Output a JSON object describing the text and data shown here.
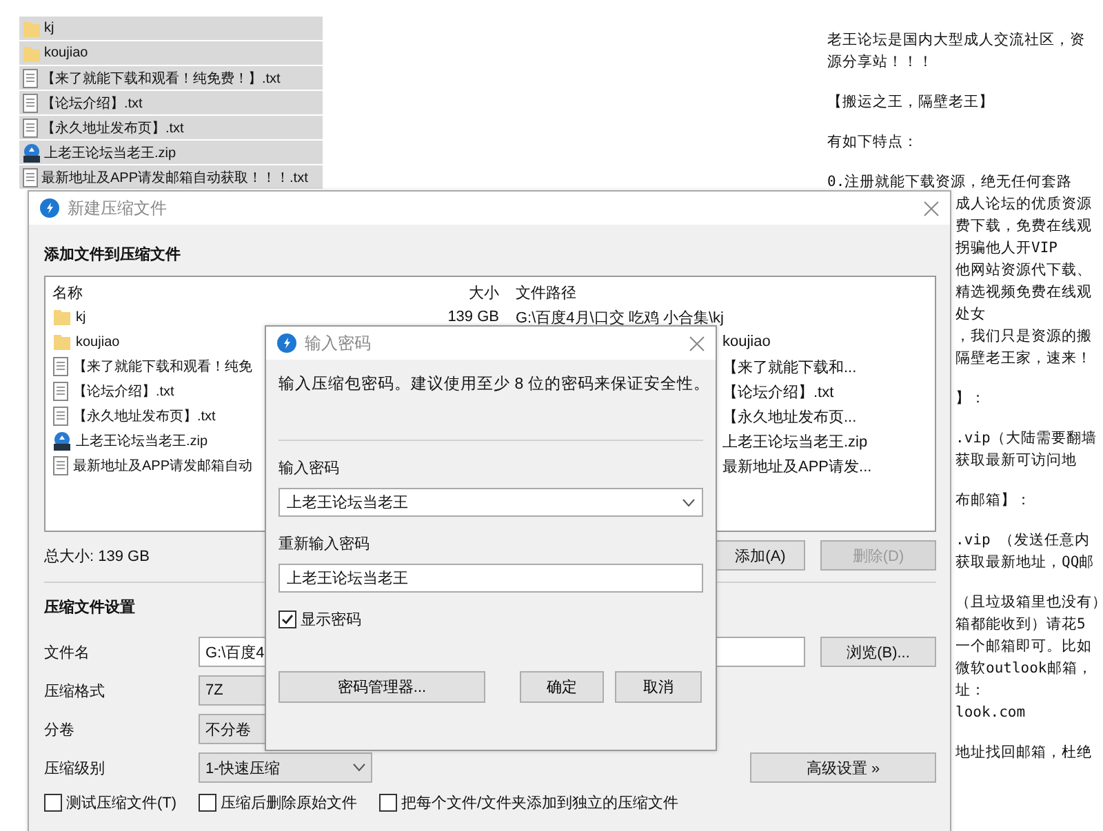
{
  "desktop_files": [
    {
      "name": "kj",
      "kind": "folder"
    },
    {
      "name": "koujiao",
      "kind": "folder"
    },
    {
      "name": "【来了就能下载和观看！纯免费！】.txt",
      "kind": "text"
    },
    {
      "name": "【论坛介绍】.txt",
      "kind": "text"
    },
    {
      "name": "【永久地址发布页】.txt",
      "kind": "text"
    },
    {
      "name": "上老王论坛当老王.zip",
      "kind": "zip"
    },
    {
      "name": "最新地址及APP请发邮箱自动获取！！！.txt",
      "kind": "text"
    }
  ],
  "notepad": {
    "paragraphs": [
      {
        "lines": [
          "老王论坛是国内大型成人交流社区，资",
          "源分享站！！！"
        ]
      },
      {
        "lines": [
          "【搬运之王，隔壁老王】"
        ]
      },
      {
        "lines": [
          "有如下特点："
        ]
      },
      {
        "lines": [
          "0.注册就能下载资源，绝无任何套路"
        ]
      }
    ],
    "clipped_paragraphs": [
      {
        "lines": [
          "成人论坛的优质资源",
          "费下载，免费在线观",
          "拐骗他人开VIP",
          "他网站资源代下载、",
          "精选视频免费在线观",
          "处女",
          "，我们只是资源的搬",
          "隔壁老王家，速来！"
        ]
      },
      {
        "lines": [
          "】："
        ]
      },
      {
        "lines": [
          ".vip（大陆需要翻墙",
          "获取最新可访问地"
        ]
      },
      {
        "lines": [
          "布邮箱】："
        ]
      },
      {
        "lines": [
          ".vip （发送任意内",
          "获取最新地址，QQ邮"
        ]
      },
      {
        "lines": [
          "（且垃圾箱里也没有）",
          "箱都能收到）请花5",
          "一个邮箱即可。比如",
          "微软outlook邮箱，",
          "址：",
          "look.com"
        ]
      },
      {
        "lines": [
          "地址找回邮箱，杜绝"
        ]
      }
    ]
  },
  "compress_window": {
    "title": "新建压缩文件",
    "section_title": "添加文件到压缩文件",
    "columns": [
      "名称",
      "大小",
      "文件路径"
    ],
    "files": [
      {
        "name": "kj",
        "kind": "folder",
        "size": "139 GB",
        "path": "G:\\百度4月\\口交 吃鸡 小合集\\kj",
        "covered": false
      },
      {
        "name": "koujiao",
        "kind": "folder",
        "path": "koujiao",
        "covered": true
      },
      {
        "name": "【来了就能下载和观看！纯免",
        "kind": "text",
        "path": "【来了就能下载和...",
        "covered": true
      },
      {
        "name": "【论坛介绍】.txt",
        "kind": "text",
        "path": "【论坛介绍】.txt",
        "covered": true
      },
      {
        "name": "【永久地址发布页】.txt",
        "kind": "text",
        "path": "【永久地址发布页...",
        "covered": true
      },
      {
        "name": "上老王论坛当老王.zip",
        "kind": "zip",
        "path": "上老王论坛当老王.zip",
        "covered": true
      },
      {
        "name": "最新地址及APP请发邮箱自动",
        "kind": "text",
        "path": "最新地址及APP请发...",
        "covered": true
      }
    ],
    "total_size": "总大小: 139 GB",
    "list_buttons": [
      {
        "label": "添加(A)",
        "disabled": false
      },
      {
        "label": "删除(D)",
        "disabled": true
      }
    ],
    "settings_title": "压缩文件设置",
    "fields": [
      {
        "label": "文件名",
        "kind": "input",
        "value": "G:\\百度4"
      },
      {
        "label": "压缩格式",
        "kind": "select",
        "value": "7Z"
      },
      {
        "label": "分卷",
        "kind": "select",
        "value": "不分卷"
      },
      {
        "label": "压缩级别",
        "kind": "select",
        "value": "1-快速压缩"
      }
    ],
    "browse_button": "浏览(B)...",
    "advanced_button": "高级设置 »",
    "options": [
      {
        "label": "测试压缩文件(T)",
        "checked": false
      },
      {
        "label": "压缩后删除原始文件",
        "checked": false
      },
      {
        "label": "把每个文件/文件夹添加到独立的压缩文件",
        "checked": false
      }
    ]
  },
  "password_dialog": {
    "title": "输入密码",
    "description": "输入压缩包密码。建议使用至少 8 位的密码来保证安全性。",
    "password_label": "输入密码",
    "password_value": "上老王论坛当老王",
    "confirm_label": "重新输入密码",
    "confirm_value": "上老王论坛当老王",
    "show_password": {
      "label": "显示密码",
      "checked": true
    },
    "buttons": [
      "密码管理器...",
      "确定",
      "取消"
    ]
  }
}
